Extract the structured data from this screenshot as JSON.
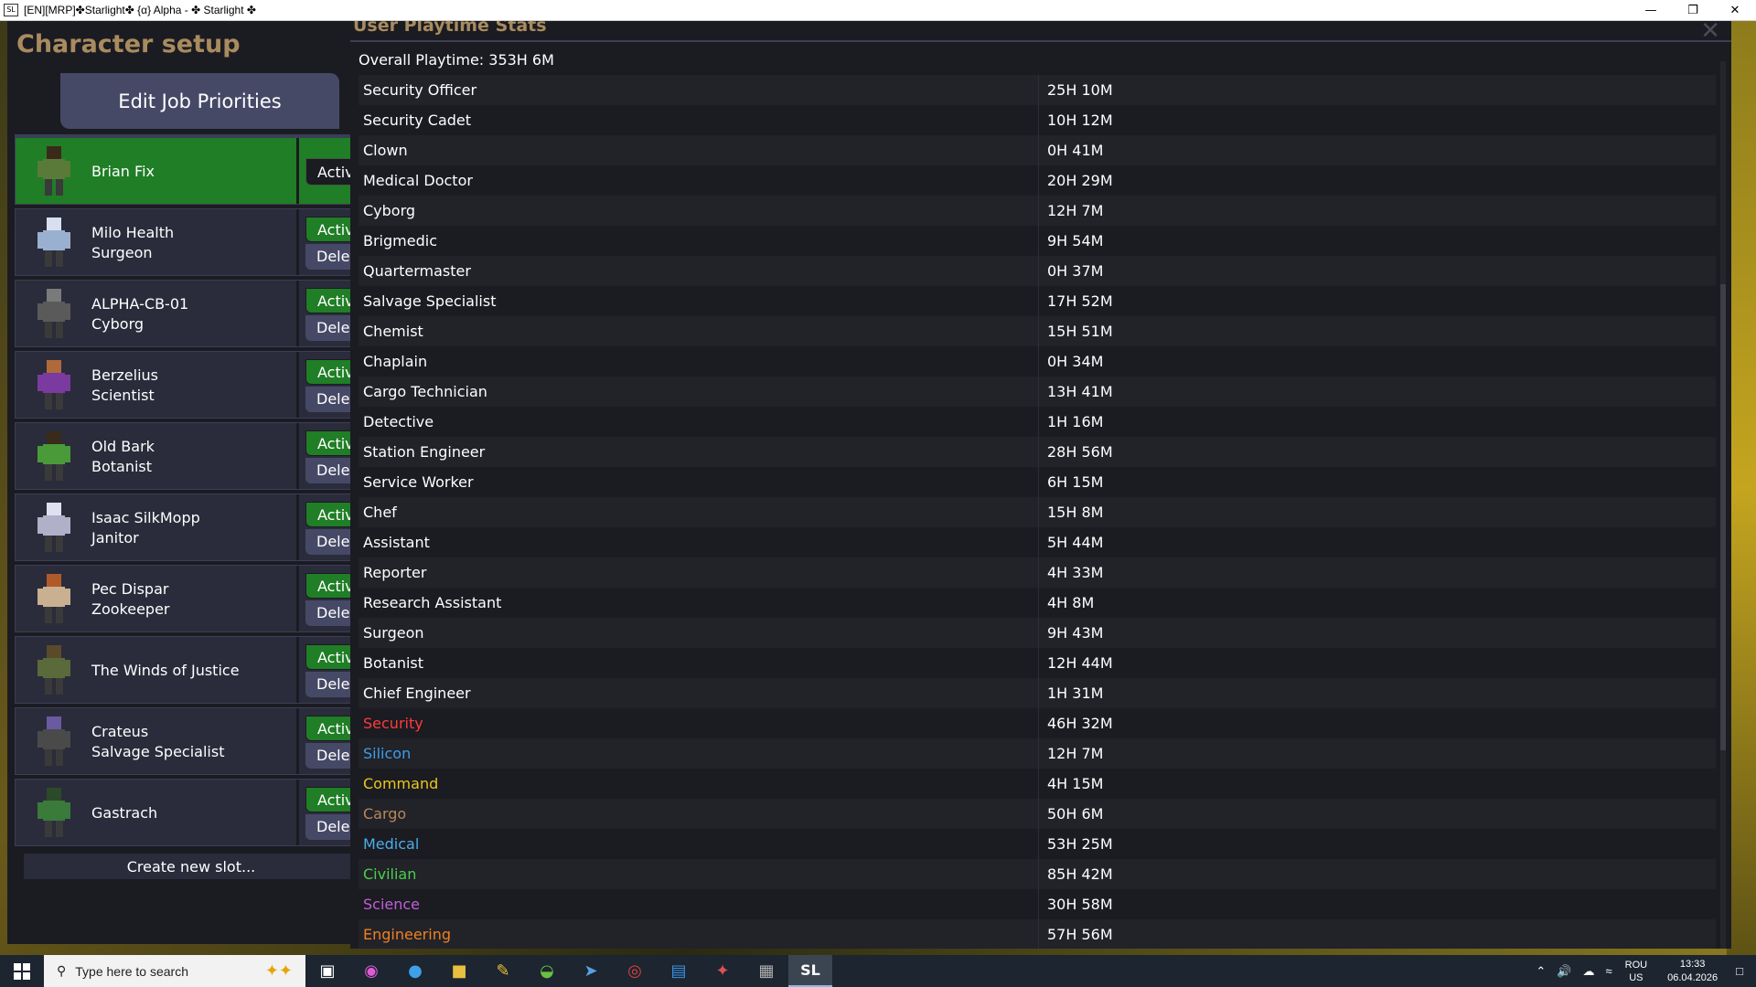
{
  "window": {
    "title": "[EN][MRP]✤Starlight✤ {α} Alpha - ✤ Starlight ✤",
    "app_icon": "SL",
    "minimize": "—",
    "restore": "❐",
    "close": "✕"
  },
  "character_setup": {
    "heading": "Character setup",
    "edit_job_priorities": "Edit Job Priorities",
    "create_new_slot": "Create new slot...",
    "active_label": "Active",
    "delete_label": "Delet",
    "slots": [
      {
        "name": "Brian Fix",
        "job": "",
        "selected": true,
        "color": "#3a2a1a",
        "body": "#5a7a3a"
      },
      {
        "name": "Milo Health",
        "job": "Surgeon",
        "selected": false,
        "color": "#d8e0f0",
        "body": "#9ab0d0"
      },
      {
        "name": "ALPHA-CB-01",
        "job": "Cyborg",
        "selected": false,
        "color": "#7a7a7a",
        "body": "#5a5a5a"
      },
      {
        "name": "Berzelius",
        "job": "Scientist",
        "selected": false,
        "color": "#b06a3a",
        "body": "#7a3aa0"
      },
      {
        "name": "Old Bark",
        "job": "Botanist",
        "selected": false,
        "color": "#3a2a1a",
        "body": "#4a9a3a"
      },
      {
        "name": "Isaac SilkMopp",
        "job": "Janitor",
        "selected": false,
        "color": "#e0e0f0",
        "body": "#b0b0c8"
      },
      {
        "name": "Pec Dispar",
        "job": "Zookeeper",
        "selected": false,
        "color": "#b05a2a",
        "body": "#c8b090"
      },
      {
        "name": "The Winds of Justice",
        "job": "",
        "selected": false,
        "color": "#5a4a2a",
        "body": "#5a6a3a"
      },
      {
        "name": "Crateus",
        "job": "Salvage Specialist",
        "selected": false,
        "color": "#6a5aa0",
        "body": "#4a4a4a"
      },
      {
        "name": "Gastrach",
        "job": "",
        "selected": false,
        "color": "#2a4a2a",
        "body": "#3a7a3a"
      }
    ]
  },
  "playtime": {
    "title": "User Playtime Stats",
    "close": "✕",
    "overall": "Overall Playtime: 353H 6M",
    "rows": [
      {
        "role": "Security Officer",
        "time": "25H 10M",
        "color": "#ffffff"
      },
      {
        "role": "Security Cadet",
        "time": "10H 12M",
        "color": "#ffffff"
      },
      {
        "role": "Clown",
        "time": "0H 41M",
        "color": "#ffffff"
      },
      {
        "role": "Medical Doctor",
        "time": "20H 29M",
        "color": "#ffffff"
      },
      {
        "role": "Cyborg",
        "time": "12H 7M",
        "color": "#ffffff"
      },
      {
        "role": "Brigmedic",
        "time": "9H 54M",
        "color": "#ffffff"
      },
      {
        "role": "Quartermaster",
        "time": "0H 37M",
        "color": "#ffffff"
      },
      {
        "role": "Salvage Specialist",
        "time": "17H 52M",
        "color": "#ffffff"
      },
      {
        "role": "Chemist",
        "time": "15H 51M",
        "color": "#ffffff"
      },
      {
        "role": "Chaplain",
        "time": "0H 34M",
        "color": "#ffffff"
      },
      {
        "role": "Cargo Technician",
        "time": "13H 41M",
        "color": "#ffffff"
      },
      {
        "role": "Detective",
        "time": "1H 16M",
        "color": "#ffffff"
      },
      {
        "role": "Station Engineer",
        "time": "28H 56M",
        "color": "#ffffff"
      },
      {
        "role": "Service Worker",
        "time": "6H 15M",
        "color": "#ffffff"
      },
      {
        "role": "Chef",
        "time": "15H 8M",
        "color": "#ffffff"
      },
      {
        "role": "Assistant",
        "time": "5H 44M",
        "color": "#ffffff"
      },
      {
        "role": "Reporter",
        "time": "4H 33M",
        "color": "#ffffff"
      },
      {
        "role": "Research Assistant",
        "time": "4H 8M",
        "color": "#ffffff"
      },
      {
        "role": "Surgeon",
        "time": "9H 43M",
        "color": "#ffffff"
      },
      {
        "role": "Botanist",
        "time": "12H 44M",
        "color": "#ffffff"
      },
      {
        "role": "Chief Engineer",
        "time": "1H 31M",
        "color": "#ffffff"
      },
      {
        "role": "Security",
        "time": "46H 32M",
        "color": "#ff3b3b"
      },
      {
        "role": "Silicon",
        "time": "12H 7M",
        "color": "#3aa0e8"
      },
      {
        "role": "Command",
        "time": "4H 15M",
        "color": "#e8c81a"
      },
      {
        "role": "Cargo",
        "time": "50H 6M",
        "color": "#b8865a"
      },
      {
        "role": "Medical",
        "time": "53H 25M",
        "color": "#4aaee8"
      },
      {
        "role": "Civilian",
        "time": "85H 42M",
        "color": "#4ad04a"
      },
      {
        "role": "Science",
        "time": "30H 58M",
        "color": "#c060d8"
      },
      {
        "role": "Engineering",
        "time": "57H 56M",
        "color": "#f08020"
      }
    ]
  },
  "taskbar": {
    "search_placeholder": "Type here to search",
    "lang_top": "ROU",
    "lang_bottom": "US",
    "time": "13:33",
    "date": "06.04.2026",
    "apps": [
      "task-view-icon",
      "copilot-icon",
      "edge-icon",
      "file-explorer-icon",
      "pen-icon",
      "utorrent-icon",
      "ship-icon",
      "chrome-icon",
      "store-icon",
      "game-icon",
      "remote-icon",
      "starlight-icon"
    ],
    "active_app_label": "SL"
  }
}
